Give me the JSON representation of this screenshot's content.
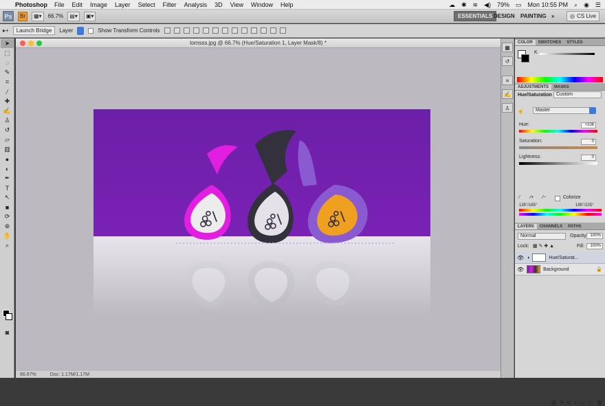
{
  "menubar": {
    "app_name": "Photoshop",
    "items": [
      "File",
      "Edit",
      "Image",
      "Layer",
      "Select",
      "Filter",
      "Analysis",
      "3D",
      "View",
      "Window",
      "Help"
    ],
    "battery": "79%",
    "clock": "Mon 10:55 PM"
  },
  "appbar": {
    "logo": "Ps",
    "zoom": "66.7%",
    "workspaces": [
      "ESSENTIALS",
      "DESIGN",
      "PAINTING"
    ],
    "more": "»",
    "cs_live": "CS Live"
  },
  "options": {
    "launch_bridge": "Launch Bridge",
    "layer_select": "Layer",
    "show_transform": "Show Transform Controls"
  },
  "document": {
    "title": "tomsss.jpg @ 66.7% (Hue/Saturation 1, Layer Mask/8) *",
    "status_zoom": "66.67%",
    "status_info": "Doc: 1.17M/1.17M"
  },
  "panels": {
    "color_tabs": [
      "COLOR",
      "SWATCHES",
      "STYLES"
    ],
    "color_k_label": "K",
    "adj_tabs": [
      "ADJUSTMENTS",
      "MASKS"
    ],
    "adj_title": "Hue/Saturation",
    "adj_preset": "Custom",
    "channel": "Master",
    "hue_label": "Hue:",
    "hue_value": "+106",
    "sat_label": "Saturation:",
    "sat_value": "0",
    "light_label": "Lightness:",
    "light_value": "0",
    "colorize": "Colorize",
    "range_left": "135°/165°",
    "range_right": "195°/225°",
    "layer_tabs": [
      "LAYERS",
      "CHANNELS",
      "PATHS"
    ],
    "blend_mode": "Normal",
    "opacity_label": "Opacity:",
    "opacity_value": "100%",
    "lock_label": "Lock:",
    "fill_label": "Fill:",
    "fill_value": "100%",
    "layers": [
      {
        "name": "Hue/Saturat..."
      },
      {
        "name": "Background"
      }
    ]
  }
}
